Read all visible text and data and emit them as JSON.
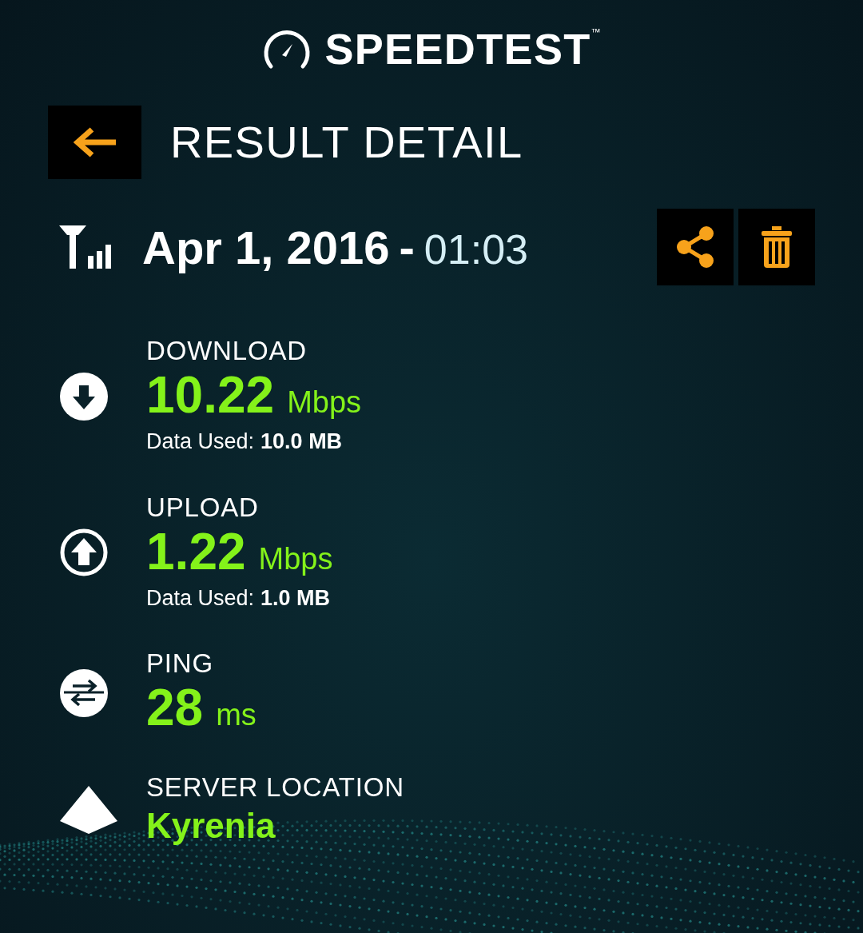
{
  "logo": {
    "text": "SPEEDTEST",
    "mark": "™"
  },
  "header": {
    "title": "RESULT DETAIL"
  },
  "result": {
    "date": "Apr 1, 2016",
    "separator": "-",
    "time": "01:03"
  },
  "metrics": [
    {
      "kind": "download",
      "label": "DOWNLOAD",
      "value": "10.22",
      "unit": "Mbps",
      "data_label": "Data Used:",
      "data_value": "10.0 MB"
    },
    {
      "kind": "upload",
      "label": "UPLOAD",
      "value": "1.22",
      "unit": "Mbps",
      "data_label": "Data Used:",
      "data_value": "1.0 MB"
    },
    {
      "kind": "ping",
      "label": "PING",
      "value": "28",
      "unit": "ms"
    },
    {
      "kind": "server",
      "label": "SERVER LOCATION",
      "value": "Kyrenia"
    }
  ]
}
